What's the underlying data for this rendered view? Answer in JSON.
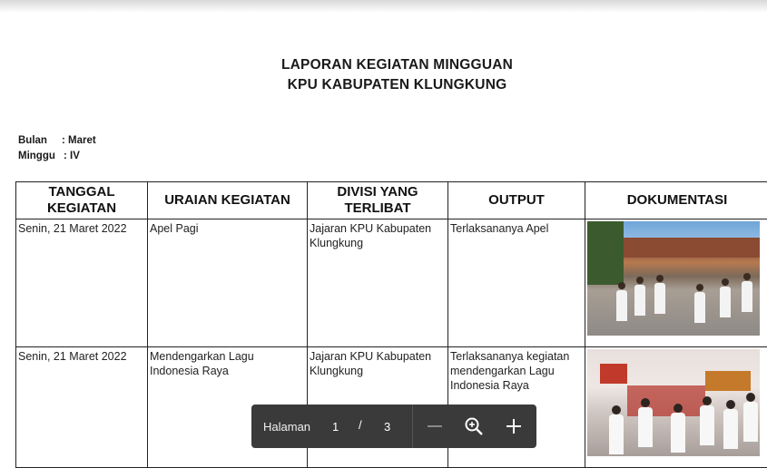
{
  "document": {
    "title_line1": "LAPORAN KEGIATAN MINGGUAN",
    "title_line2": "KPU KABUPATEN KLUNGKUNG",
    "bulan_label": "Bulan",
    "bulan_value": ": Maret",
    "minggu_label": "Minggu",
    "minggu_value": ": IV"
  },
  "table": {
    "headers": [
      "TANGGAL KEGIATAN",
      "URAIAN KEGIATAN",
      "DIVISI YANG TERLIBAT",
      "OUTPUT",
      "DOKUMENTASI"
    ],
    "rows": [
      {
        "tanggal": "Senin, 21 Maret 2022",
        "uraian": "Apel Pagi",
        "divisi": "Jajaran KPU Kabupaten Klungkung",
        "output": "Terlaksananya Apel",
        "photo_kind": "outdoor-assembly-photo"
      },
      {
        "tanggal": "Senin, 21 Maret 2022",
        "uraian": "Mendengarkan Lagu Indonesia Raya",
        "divisi": "Jajaran KPU Kabupaten Klungkung",
        "output": "Terlaksananya kegiatan mendengarkan Lagu Indonesia Raya",
        "photo_kind": "indoor-assembly-photo"
      }
    ]
  },
  "viewer": {
    "page_label": "Halaman",
    "current_page": "1",
    "separator": "/",
    "total_pages": "3",
    "icons": [
      "minus-icon",
      "zoom-icon",
      "plus-icon"
    ]
  }
}
